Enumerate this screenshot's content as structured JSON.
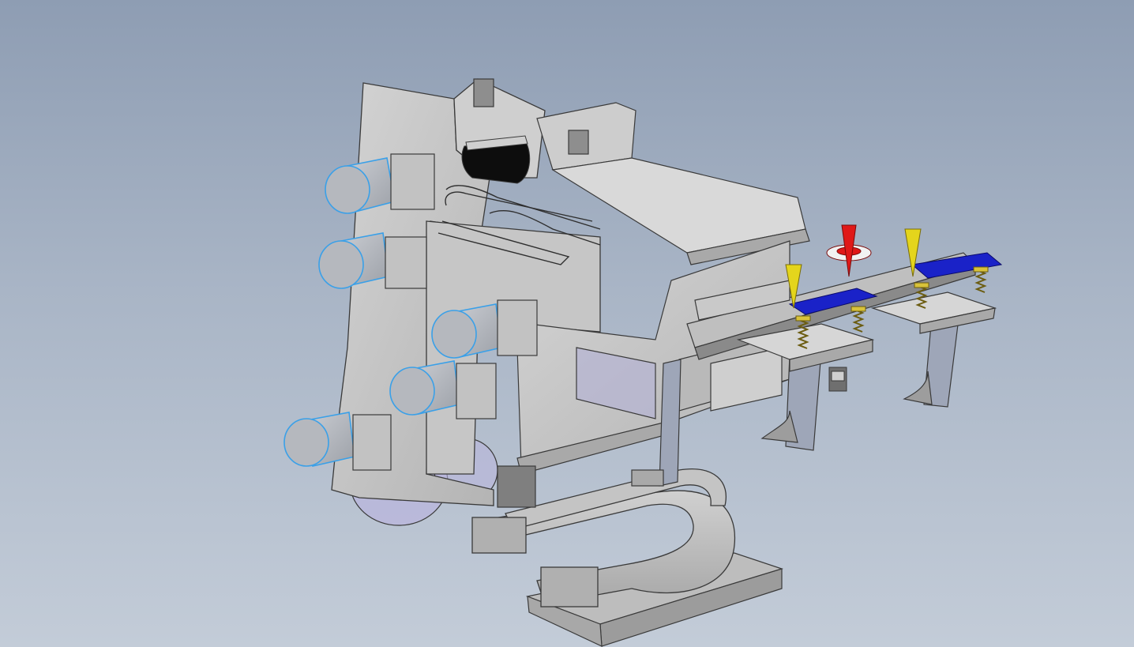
{
  "viewport": {
    "background_top": "#8e9db3",
    "background_bottom": "#c3ccd8"
  },
  "model": {
    "part_color": "#c9c9c9",
    "edge_color": "#3a3a3a",
    "motor_color": "#b5b8be",
    "motor_edge_color": "#3aa0e8",
    "conveyor_pad_color": "#1a22c8",
    "spring_color": "#d8c23a",
    "cone_marker_color": "#e4d51c",
    "gravity_marker_color": "#e01818",
    "transparent_part_color": "#b9b6dc",
    "motor_count": 5,
    "cone_markers": [
      "cone-marker-left",
      "cone-marker-right"
    ]
  }
}
